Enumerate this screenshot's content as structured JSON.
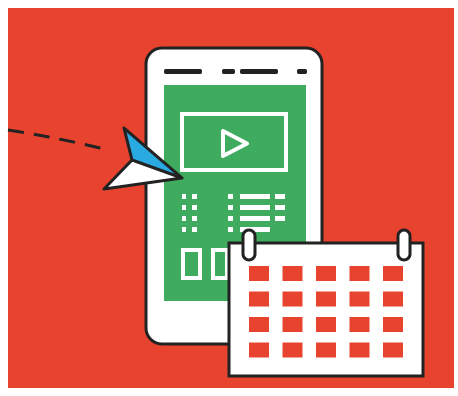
{
  "illustration": {
    "colors": {
      "background": "#e8432e",
      "phone_body": "#ffffff",
      "outline": "#222222",
      "screen": "#3fab5f",
      "screen_lines": "#ffffff",
      "plane_blue": "#29abe2",
      "plane_white": "#ffffff",
      "calendar_body": "#ffffff",
      "calendar_cell": "#e8432e"
    },
    "icons": {
      "phone": "smartphone-icon",
      "video": "play-video-icon",
      "plane": "paper-plane-icon",
      "calendar": "calendar-icon"
    },
    "calendar_grid": {
      "rows": 4,
      "columns": 5
    }
  }
}
